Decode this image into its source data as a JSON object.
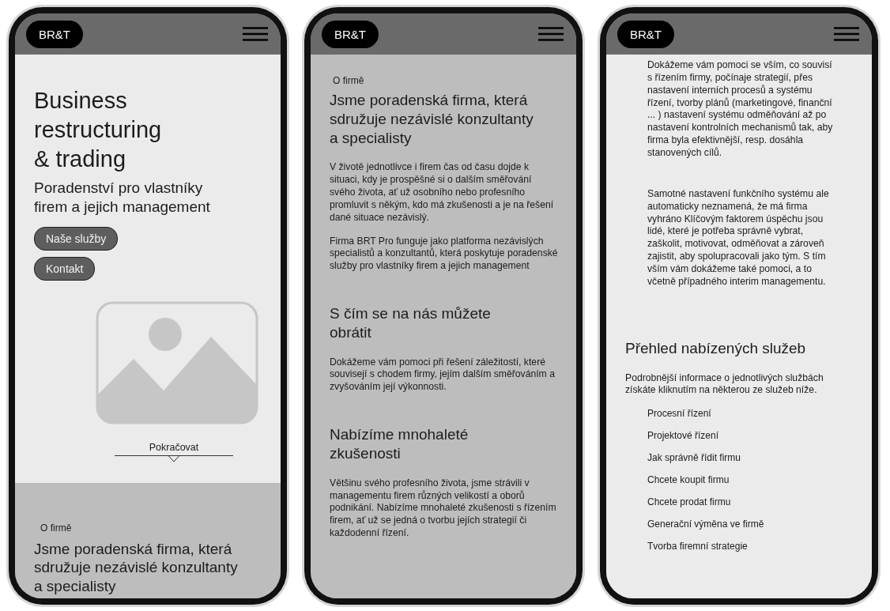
{
  "screens": [
    {
      "logo": "BR&T",
      "sections": [
        {
          "kind": "light",
          "blocks": [
            {
              "kind": "title",
              "text": "Business\nrestructuring\n& trading"
            },
            {
              "kind": "subtitle",
              "text": "Poradenství pro vlastníky\nfirem a jejich management"
            },
            {
              "kind": "button",
              "text": "Naše služby"
            },
            {
              "kind": "button",
              "text": "Kontakt"
            },
            {
              "kind": "image"
            },
            {
              "kind": "continue",
              "text": "Pokračovat"
            }
          ]
        },
        {
          "kind": "mid",
          "blocks": [
            {
              "kind": "label",
              "text": "O firmě"
            },
            {
              "kind": "heading",
              "text": "Jsme poradenská firma, která\nsdružuje nezávislé konzultanty\na specialisty"
            }
          ]
        }
      ]
    },
    {
      "logo": "BR&T",
      "sections": [
        {
          "kind": "mid",
          "blocks": [
            {
              "kind": "label",
              "text": "O firmě"
            },
            {
              "kind": "heading",
              "text": "Jsme poradenská firma, která\nsdružuje nezávislé konzultanty\na specialisty"
            },
            {
              "kind": "paragraph",
              "text": "V životě jednotlivce i firem čas od času dojde k situaci, kdy je prospěšné si o dalším směřování svého života, ať už osobního nebo profesního promluvit s někým, kdo má zkušenosti a je na řešení dané situace nezávislý."
            },
            {
              "kind": "paragraph",
              "text": "Firma BRT Pro funguje jako platforma nezávislých specialistů a konzultantů, která poskytuje poradenské služby pro vlastníky firem a jejich management"
            },
            {
              "kind": "heading",
              "text": "S čím se na nás můžete\nobrátit"
            },
            {
              "kind": "paragraph",
              "text": "Dokážeme vám pomoci při řešení záležitostí, které souvisejí s chodem firmy, jejím dalším směřováním a zvyšováním její výkonnosti."
            },
            {
              "kind": "heading",
              "text": "Nabízíme mnohaleté\nzkušenosti"
            },
            {
              "kind": "paragraph",
              "text": "Většinu svého profesního života, jsme strávili v managementu firem různých velikostí a oborů podnikání. Nabízíme mnohaleté zkušenosti s řízením firem, ať už se jedná o tvorbu jejích strategií či každodenní řízení."
            }
          ]
        }
      ]
    },
    {
      "logo": "BR&T",
      "sections": [
        {
          "kind": "light",
          "blocks": [
            {
              "kind": "indented",
              "text": "Dokážeme vám pomoci se vším, co souvisí s řízením firmy, počínaje strategií, přes nastavení interních procesů a systému řízení, tvorby plánů (marketingové, finanční ... ) nastavení systému odměňování až po nastavení kontrolních mechanismů tak, aby firma byla efektivnější, resp. dosáhla stanovených cílů."
            },
            {
              "kind": "indented",
              "text": "Samotné nastavení funkčního systému ale automaticky neznamená, že má firma vyhráno Klíčovým faktorem úspěchu jsou lidé, které je potřeba správně vybrat, zaškolit, motivovat, odměňovat a zároveň zajistit, aby spolupracovali jako tým. S tím vším vám dokážeme také pomoci, a to včetně případného interim managementu."
            },
            {
              "kind": "heading",
              "text": "Přehled nabízených služeb"
            },
            {
              "kind": "paragraph",
              "text": "Podrobnější informace o jednotlivých službách získáte kliknutím na některou ze služeb níže."
            },
            {
              "kind": "link",
              "text": "Procesní řízení"
            },
            {
              "kind": "link",
              "text": "Projektové řízení"
            },
            {
              "kind": "link",
              "text": "Jak správně řídit firmu"
            },
            {
              "kind": "link",
              "text": "Chcete koupit firmu"
            },
            {
              "kind": "link",
              "text": "Chcete prodat firmu"
            },
            {
              "kind": "link",
              "text": "Generační výměna ve firmě"
            },
            {
              "kind": "link",
              "text": "Tvorba firemní strategie"
            }
          ]
        }
      ]
    }
  ]
}
